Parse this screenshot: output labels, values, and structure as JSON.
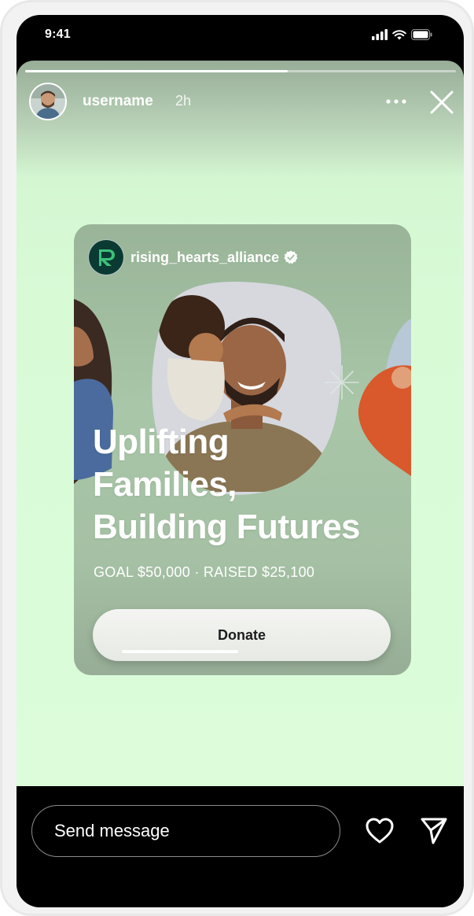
{
  "status_bar": {
    "time": "9:41",
    "icons": [
      "signal-icon",
      "wifi-icon",
      "battery-icon"
    ]
  },
  "story": {
    "progress": 0.61,
    "username": "username",
    "time_ago": "2h",
    "icons": {
      "more": "more-icon",
      "close": "close-icon"
    }
  },
  "ad": {
    "brand_name": "rising_hearts_alliance",
    "brand_logo_letter": "R",
    "headline": [
      "Uplifting",
      "Families,",
      "Building Futures"
    ],
    "goal_line": "GOAL $50,000 · RAISED $25,100",
    "donate_label": "Donate",
    "donate_progress": 0.5
  },
  "reply_bar": {
    "placeholder": "Send message",
    "icons": {
      "like": "heart-icon",
      "share": "send-icon"
    }
  },
  "colors": {
    "story_bg": "#dcfcda",
    "card_bg": "#a9c6a8",
    "brand_logo_bg": "#0b3a33",
    "brand_logo_accent": "#3cc27a"
  }
}
